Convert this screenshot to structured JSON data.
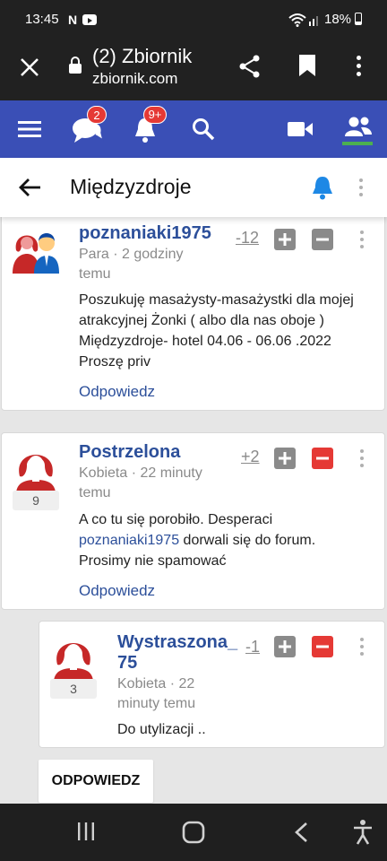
{
  "status_bar": {
    "time": "13:45",
    "battery": "18%"
  },
  "browser": {
    "title": "(2) Zbiornik",
    "url": "zbiornik.com"
  },
  "app_bar": {
    "messages_badge": "2",
    "notifications_badge": "9+"
  },
  "page": {
    "title": "Międzyzdroje"
  },
  "posts": [
    {
      "username": "poznaniaki1975",
      "meta": [
        "Para · 2 godziny",
        "temu"
      ],
      "score": "-12",
      "body": [
        "Poszukuję masażysty-masażystki dla mojej",
        "atrakcyjnej Żonki ( albo dla nas oboje )",
        "Międzyzdroje- hotel 04.06 - 06.06 .2022",
        "Proszę priv"
      ],
      "reply": "Odpowiedz"
    },
    {
      "username": "Postrzelona",
      "meta": [
        "Kobieta · 22 minuty",
        "temu"
      ],
      "score": "+2",
      "avatar_count": "9",
      "body_line1": "A co tu się porobiło. Desperaci",
      "mention": "poznaniaki1975",
      "body_line2_rest": " dorwali się do forum.",
      "body_line3": "Prosimy nie spamować",
      "reply": "Odpowiedz"
    },
    {
      "username": [
        "Wystraszona_",
        "75"
      ],
      "meta": [
        "Kobieta · 22",
        "minuty temu"
      ],
      "score": "-1",
      "avatar_count": "3",
      "body": "Do utylizacji .."
    }
  ],
  "reply_button": "ODPOWIEDZ",
  "colors": {
    "brand": "#3a4fb6",
    "link": "#2c4f9a",
    "red": "#e53935"
  }
}
